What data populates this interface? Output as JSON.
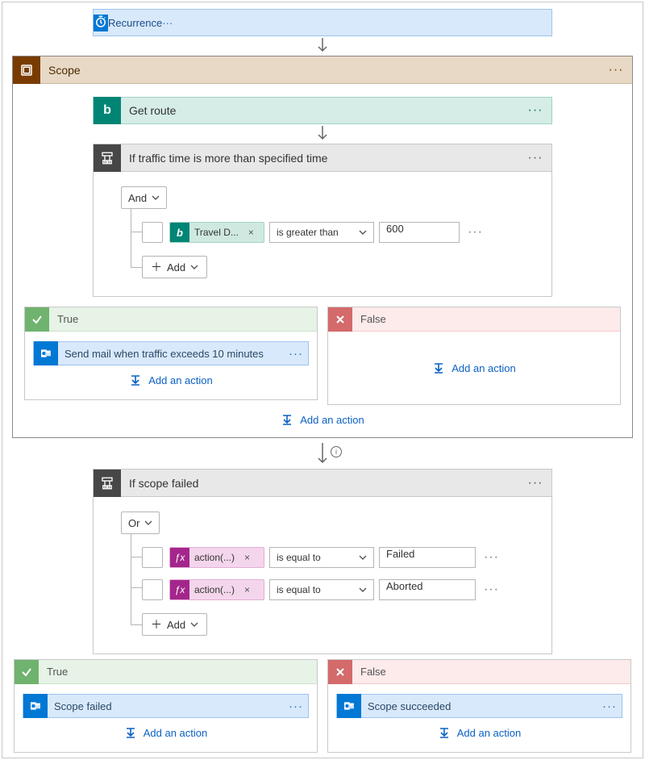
{
  "trigger": {
    "label": "Recurrence"
  },
  "scope": {
    "title": "Scope",
    "get_route": {
      "label": "Get route"
    },
    "condition": {
      "title": "If traffic time is more than specified time",
      "group_op": "And",
      "add_label": "Add",
      "rows": [
        {
          "token": "Travel D...",
          "operator": "is greater than",
          "value": "600"
        }
      ]
    },
    "branches": {
      "true_label": "True",
      "false_label": "False",
      "true_actions": [
        {
          "label": "Send mail when traffic exceeds 10 minutes"
        }
      ]
    },
    "add_action_label": "Add an action"
  },
  "condition2": {
    "title": "If scope failed",
    "group_op": "Or",
    "add_label": "Add",
    "rows": [
      {
        "token": "action(...)",
        "operator": "is equal to",
        "value": "Failed"
      },
      {
        "token": "action(...)",
        "operator": "is equal to",
        "value": "Aborted"
      }
    ]
  },
  "outer_branches": {
    "true_label": "True",
    "false_label": "False",
    "true_actions": [
      {
        "label": "Scope failed"
      }
    ],
    "false_actions": [
      {
        "label": "Scope succeeded"
      }
    ]
  },
  "links": {
    "add_action": "Add an action"
  }
}
